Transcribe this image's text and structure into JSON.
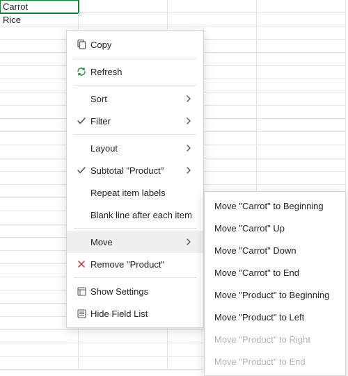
{
  "cells": {
    "a1": "Carrot",
    "a2": "Rice"
  },
  "menu": {
    "copy": "Copy",
    "refresh": "Refresh",
    "sort": "Sort",
    "filter": "Filter",
    "layout": "Layout",
    "subtotal": "Subtotal \"Product\"",
    "repeat": "Repeat item labels",
    "blankline": "Blank line after each item",
    "move": "Move",
    "remove": "Remove \"Product\"",
    "show_settings": "Show Settings",
    "hide_field_list": "Hide Field List"
  },
  "submenu": {
    "items": [
      {
        "label": "Move \"Carrot\" to Beginning",
        "enabled": true
      },
      {
        "label": "Move \"Carrot\" Up",
        "enabled": true
      },
      {
        "label": "Move \"Carrot\" Down",
        "enabled": true
      },
      {
        "label": "Move \"Carrot\" to End",
        "enabled": true
      },
      {
        "label": "Move \"Product\" to Beginning",
        "enabled": true
      },
      {
        "label": "Move \"Product\" to Left",
        "enabled": true
      },
      {
        "label": "Move \"Product\" to Right",
        "enabled": false
      },
      {
        "label": "Move \"Product\" to End",
        "enabled": false
      }
    ]
  }
}
